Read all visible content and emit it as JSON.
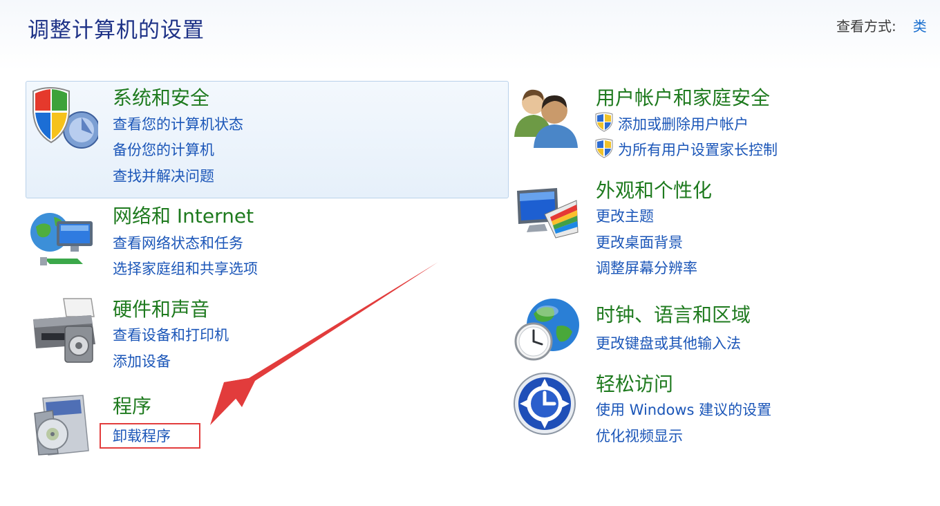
{
  "header": {
    "title": "调整计算机的设置",
    "view_by_label": "查看方式:",
    "view_by_value": "类"
  },
  "categories": [
    {
      "id": "system-security",
      "title": "系统和安全",
      "links": [
        "查看您的计算机状态",
        "备份您的计算机",
        "查找并解决问题"
      ],
      "icon": "shield-icon"
    },
    {
      "id": "network-internet",
      "title": "网络和 Internet",
      "links": [
        "查看网络状态和任务",
        "选择家庭组和共享选项"
      ],
      "icon": "network-icon"
    },
    {
      "id": "hardware-sound",
      "title": "硬件和声音",
      "links": [
        "查看设备和打印机",
        "添加设备"
      ],
      "icon": "printer-icon"
    },
    {
      "id": "programs",
      "title": "程序",
      "links": [
        "卸载程序"
      ],
      "icon": "programs-icon"
    },
    {
      "id": "user-accounts",
      "title": "用户帐户和家庭安全",
      "links": [
        "添加或删除用户帐户",
        "为所有用户设置家长控制"
      ],
      "icon": "users-icon"
    },
    {
      "id": "appearance",
      "title": "外观和个性化",
      "links": [
        "更改主题",
        "更改桌面背景",
        "调整屏幕分辨率"
      ],
      "icon": "monitor-palette-icon"
    },
    {
      "id": "clock-language",
      "title": "时钟、语言和区域",
      "links": [
        "更改键盘或其他输入法"
      ],
      "icon": "globe-clock-icon"
    },
    {
      "id": "ease-of-access",
      "title": "轻松访问",
      "links": [
        "使用 Windows 建议的设置",
        "优化视频显示"
      ],
      "icon": "ease-of-access-icon"
    }
  ],
  "colors": {
    "title": "#1e3287",
    "category_title": "#1e7a1e",
    "link": "#1b56b8",
    "annotation": "#e23c3c"
  }
}
